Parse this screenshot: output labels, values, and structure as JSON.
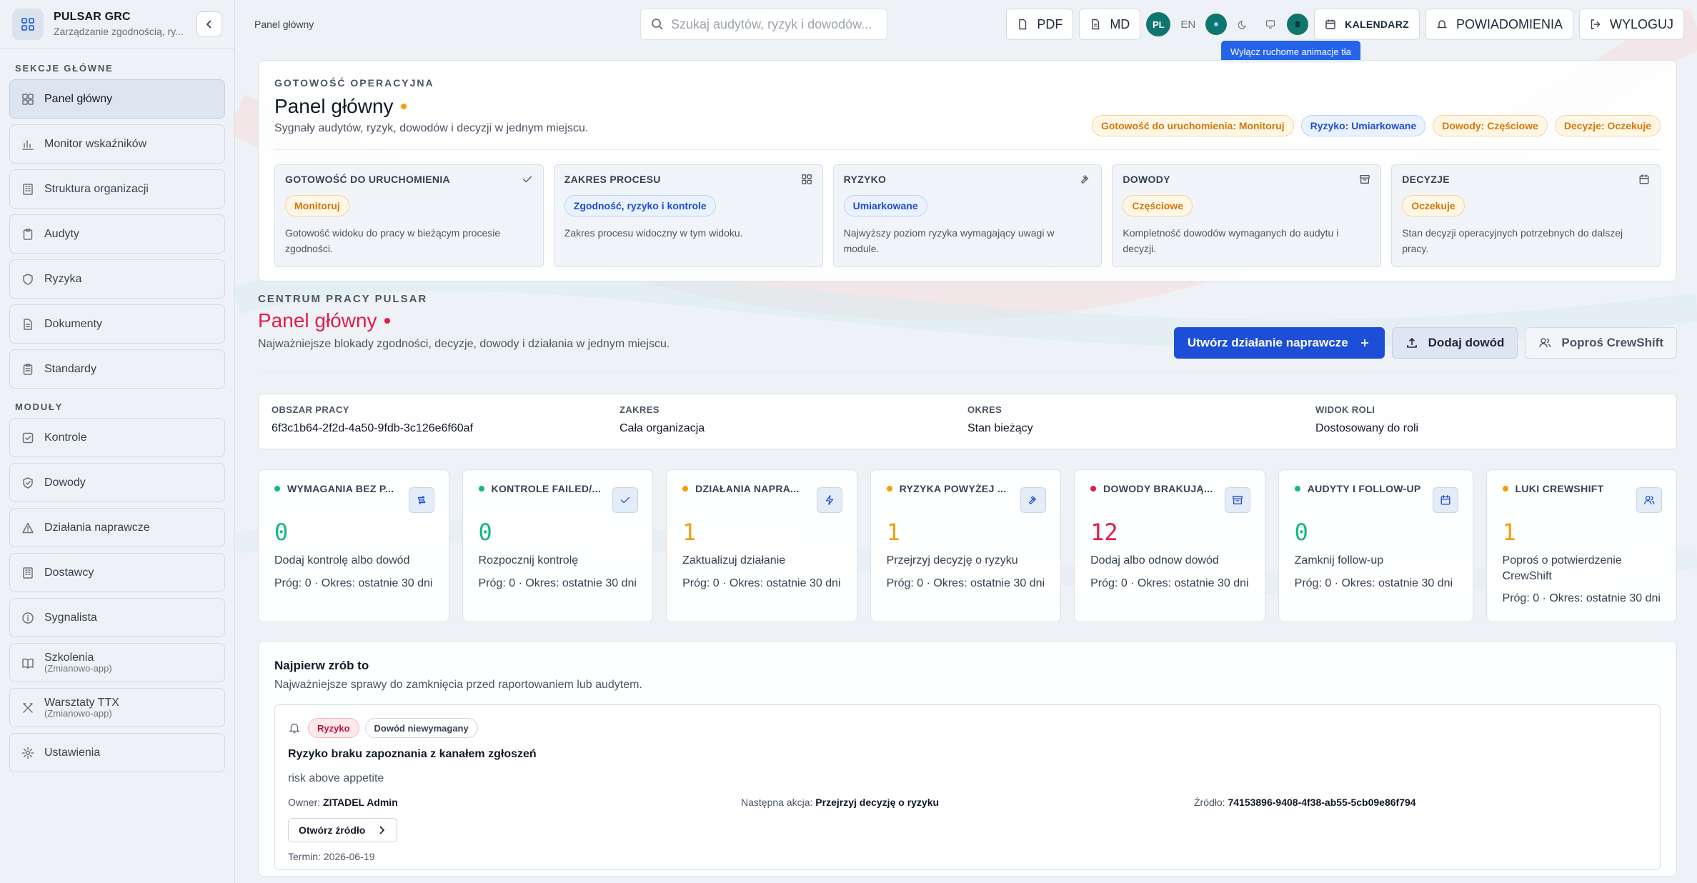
{
  "sidebar": {
    "brand_title": "PULSAR GRC",
    "brand_subtitle": "Zarządzanie zgodnością, ry...",
    "main_label": "SEKCJE GŁÓWNE",
    "main_items": [
      {
        "label": "Panel główny",
        "icon": "dashboard-icon",
        "active": true
      },
      {
        "label": "Monitor wskaźników",
        "icon": "chart-icon"
      },
      {
        "label": "Struktura organizacji",
        "icon": "building-icon"
      },
      {
        "label": "Audyty",
        "icon": "clipboard-icon"
      },
      {
        "label": "Ryzyka",
        "icon": "shield-icon"
      },
      {
        "label": "Dokumenty",
        "icon": "document-icon"
      },
      {
        "label": "Standardy",
        "icon": "clipboard-list-icon"
      }
    ],
    "modules_label": "MODUŁY",
    "module_items": [
      {
        "label": "Kontrole",
        "icon": "check-square-icon"
      },
      {
        "label": "Dowody",
        "icon": "shield-check-icon"
      },
      {
        "label": "Działania naprawcze",
        "icon": "warning-icon"
      },
      {
        "label": "Dostawcy",
        "icon": "building-icon"
      },
      {
        "label": "Sygnalista",
        "icon": "info-icon"
      },
      {
        "label": "Szkolenia",
        "sub": "(Zmianowo-app)",
        "icon": "book-icon"
      },
      {
        "label": "Warsztaty TTX",
        "sub": "(Zmianowo-app)",
        "icon": "tools-icon"
      },
      {
        "label": "Ustawienia",
        "icon": "gear-icon"
      }
    ]
  },
  "topbar": {
    "breadcrumb": "Panel główny",
    "search_placeholder": "Szukaj audytów, ryzyk i dowodów...",
    "pdf_label": "PDF",
    "md_label": "MD",
    "lang_pl": "PL",
    "lang_en": "EN",
    "calendar_label": "KALENDARZ",
    "notifications_label": "POWIADOMIENIA",
    "logout_label": "WYLOGUJ",
    "tooltip": "Wyłącz ruchome animacje tła"
  },
  "readiness": {
    "eyebrow": "GOTOWOŚĆ OPERACYJNA",
    "title": "Panel główny",
    "subtitle": "Sygnały audytów, ryzyk, dowodów i decyzji w jednym miejscu.",
    "chips": [
      {
        "label": "Gotowość do uruchomienia: Monitoruj",
        "tone": "amber"
      },
      {
        "label": "Ryzyko: Umiarkowane",
        "tone": "blue"
      },
      {
        "label": "Dowody: Częściowe",
        "tone": "amber"
      },
      {
        "label": "Decyzje: Oczekuje",
        "tone": "amber"
      }
    ],
    "cards": [
      {
        "title": "GOTOWOŚĆ DO URUCHOMIENIA",
        "icon": "check-icon",
        "pill": "Monitoruj",
        "tone": "amber",
        "desc": "Gotowość widoku do pracy w bieżącym procesie zgodności."
      },
      {
        "title": "ZAKRES PROCESU",
        "icon": "grid-icon",
        "pill": "Zgodność, ryzyko i kontrole",
        "tone": "blue",
        "desc": "Zakres procesu widoczny w tym widoku."
      },
      {
        "title": "RYZYKO",
        "icon": "gavel-icon",
        "pill": "Umiarkowane",
        "tone": "blue",
        "desc": "Najwyższy poziom ryzyka wymagający uwagi w module."
      },
      {
        "title": "DOWODY",
        "icon": "archive-icon",
        "pill": "Częściowe",
        "tone": "amber",
        "desc": "Kompletność dowodów wymaganych do audytu i decyzji."
      },
      {
        "title": "DECYZJE",
        "icon": "calendar-icon",
        "pill": "Oczekuje",
        "tone": "amber",
        "desc": "Stan decyzji operacyjnych potrzebnych do dalszej pracy."
      }
    ]
  },
  "center": {
    "eyebrow": "CENTRUM PRACY PULSAR",
    "title": "Panel główny",
    "subtitle": "Najważniejsze blokady zgodności, decyzje, dowody i działania w jednym miejscu.",
    "create_label": "Utwórz działanie naprawcze",
    "add_evidence_label": "Dodaj dowód",
    "crewshift_label": "Poproś CrewShift"
  },
  "context": [
    {
      "key": "OBSZAR PRACY",
      "value": "6f3c1b64-2f2d-4a50-9fdb-3c126e6f60af"
    },
    {
      "key": "ZAKRES",
      "value": "Cała organizacja"
    },
    {
      "key": "OKRES",
      "value": "Stan bieżący"
    },
    {
      "key": "WIDOK ROLI",
      "value": "Dostosowany do roli"
    }
  ],
  "metrics": [
    {
      "title": "WYMAGANIA BEZ P...",
      "value": "0",
      "dot": "#10b981",
      "color": "#10b981",
      "icon": "repeat-icon",
      "action": "Dodaj kontrolę albo dowód",
      "meta": "Próg: 0 · Okres: ostatnie 30 dni"
    },
    {
      "title": "KONTROLE FAILED/...",
      "value": "0",
      "dot": "#10b981",
      "color": "#10b981",
      "icon": "check-icon",
      "action": "Rozpocznij kontrolę",
      "meta": "Próg: 0 · Okres: ostatnie 30 dni"
    },
    {
      "title": "DZIAŁANIA NAPRA...",
      "value": "1",
      "dot": "#f59e0b",
      "color": "#f59e0b",
      "icon": "bolt-icon",
      "action": "Zaktualizuj działanie",
      "meta": "Próg: 0 · Okres: ostatnie 30 dni"
    },
    {
      "title": "RYZYKA POWYŻEJ ...",
      "value": "1",
      "dot": "#f59e0b",
      "color": "#f59e0b",
      "icon": "gavel-icon",
      "action": "Przejrzyj decyzję o ryzyku",
      "meta": "Próg: 0 · Okres: ostatnie 30 dni"
    },
    {
      "title": "DOWODY BRAKUJĄ...",
      "value": "12",
      "dot": "#e11d48",
      "color": "#e11d48",
      "icon": "archive-icon",
      "action": "Dodaj albo odnow dowód",
      "meta": "Próg: 0 · Okres: ostatnie 30 dni"
    },
    {
      "title": "AUDYTY I FOLLOW-UP",
      "value": "0",
      "dot": "#10b981",
      "color": "#10b981",
      "icon": "calendar-icon",
      "action": "Zamknij follow-up",
      "meta": "Próg: 0 · Okres: ostatnie 30 dni"
    },
    {
      "title": "LUKI CREWSHIFT",
      "value": "1",
      "dot": "#f59e0b",
      "color": "#f59e0b",
      "icon": "users-icon",
      "action": "Poproś o potwierdzenie CrewShift",
      "meta": "Próg: 0 · Okres: ostatnie 30 dni"
    }
  ],
  "todo": {
    "title": "Najpierw zrób to",
    "subtitle": "Najważniejsze sprawy do zamknięcia przed raportowaniem lub audytem.",
    "issue": {
      "chip_risk": "Ryzyko",
      "chip_evidence": "Dowód niewymagany",
      "title": "Ryzyko braku zapoznania z kanałem zgłoszeń",
      "desc": "risk above appetite",
      "owner_key": "Owner:",
      "owner_val": "ZITADEL Admin",
      "next_key": "Następna akcja:",
      "next_val": "Przejrzyj decyzję o ryzyku",
      "source_key": "Źródło:",
      "source_val": "74153896-9408-4f38-ab55-5cb09e86f794",
      "open_label": "Otwórz źródło",
      "due": "Termin: 2026-06-19"
    }
  }
}
